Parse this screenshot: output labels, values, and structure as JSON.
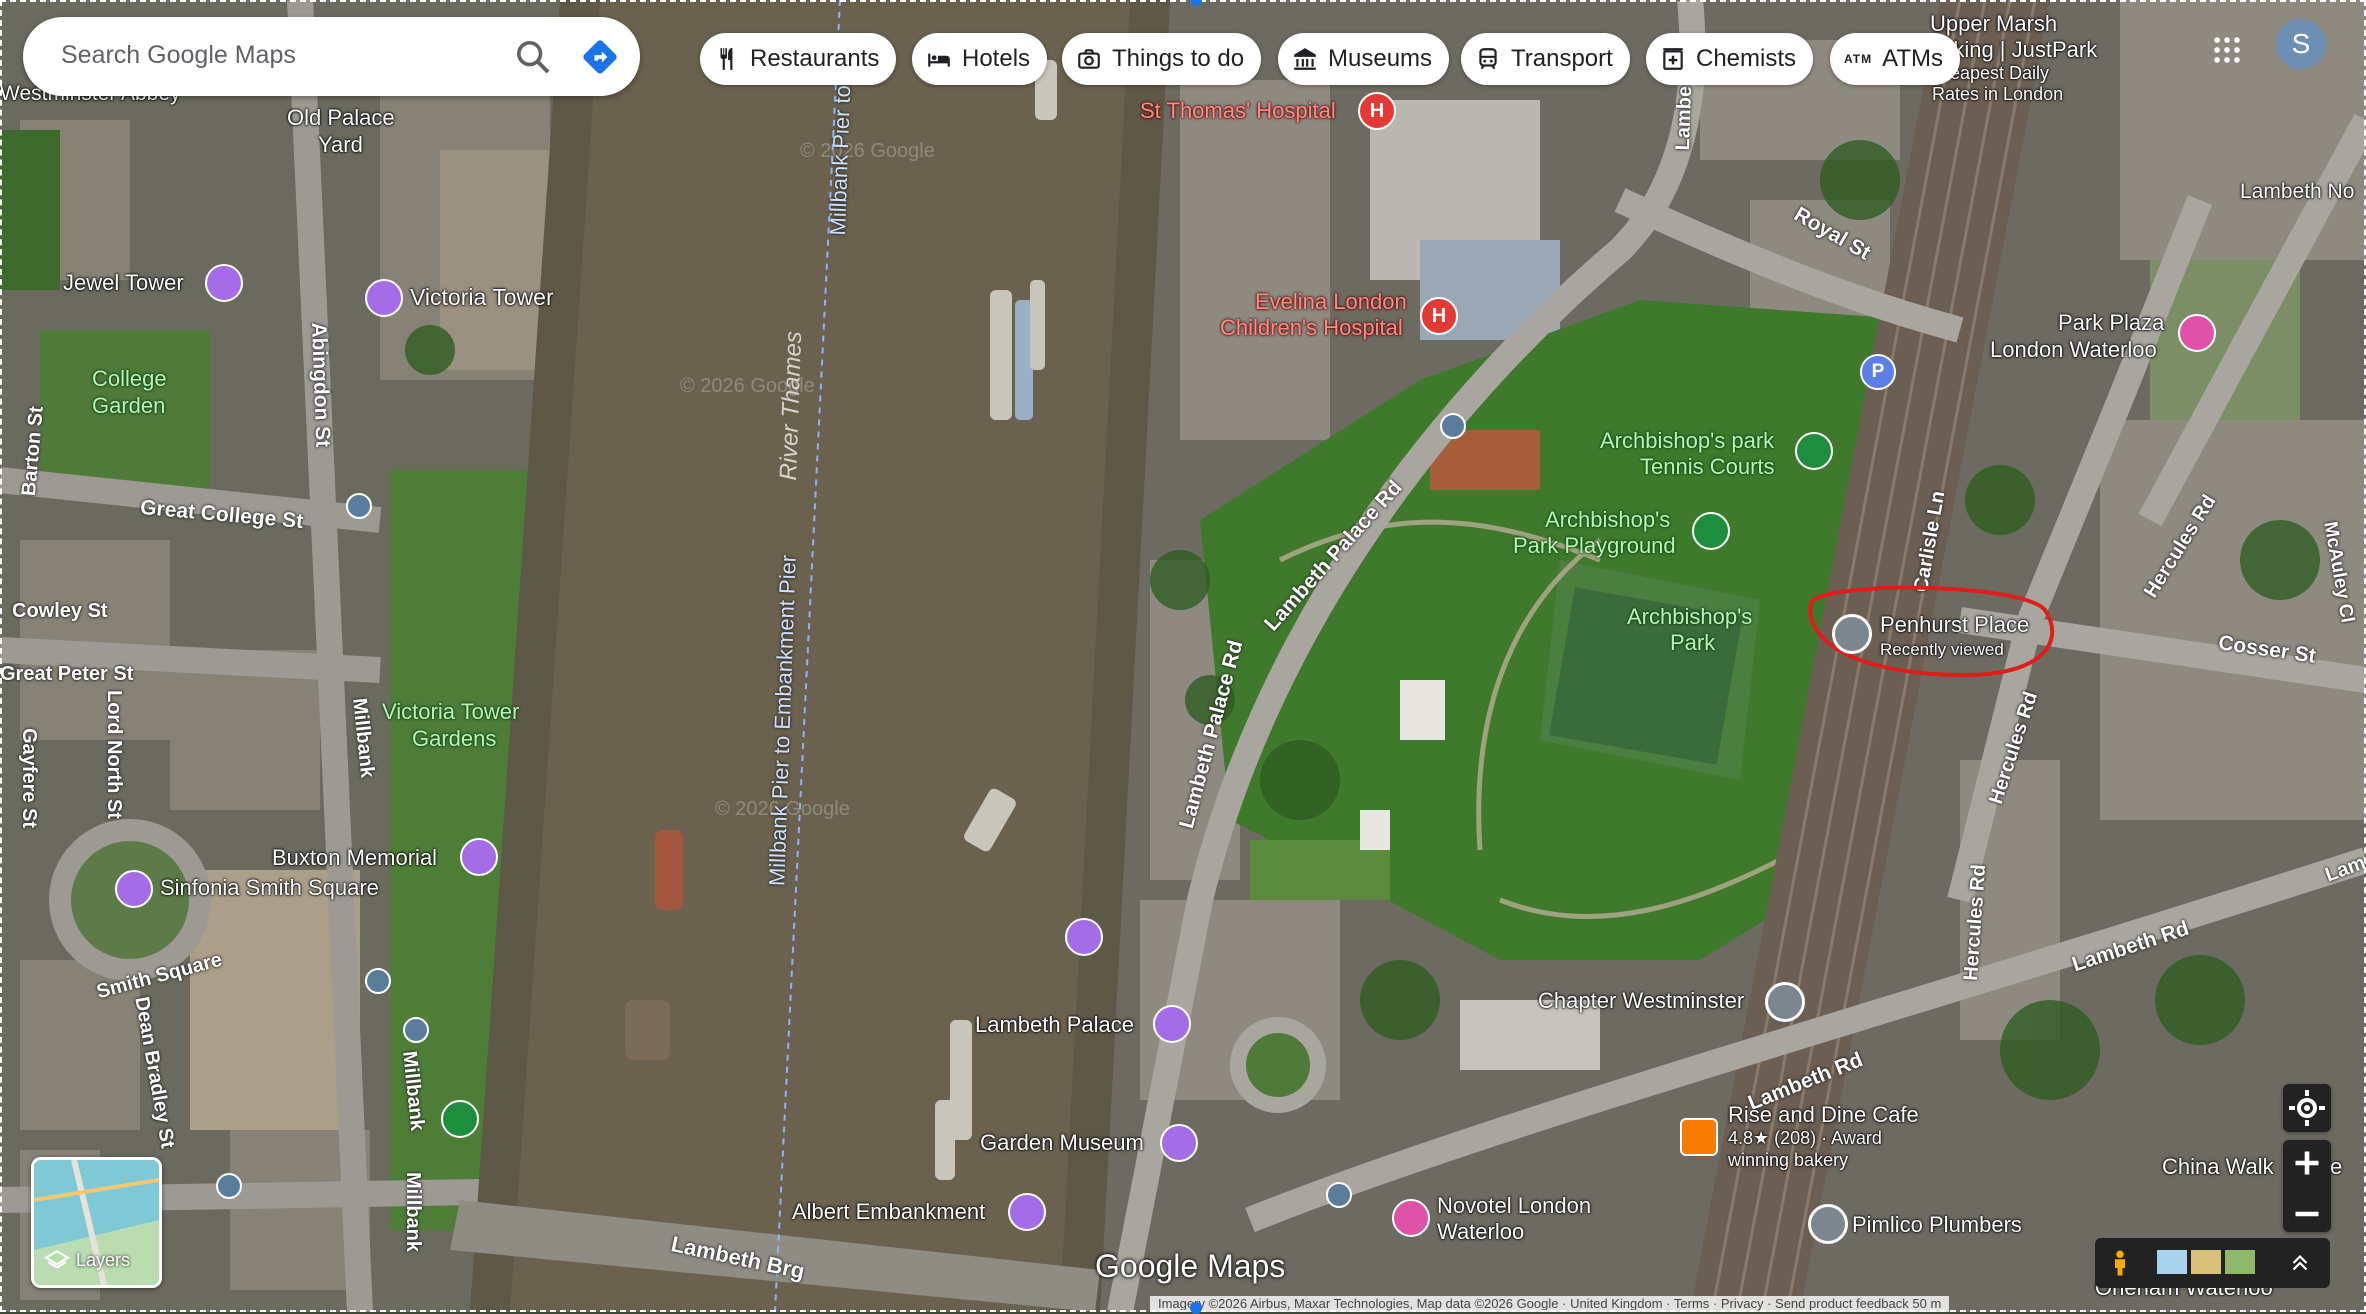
{
  "search": {
    "placeholder": "Search Google Maps"
  },
  "chips": [
    {
      "label": "Restaurants",
      "icon": "cutlery-icon"
    },
    {
      "label": "Hotels",
      "icon": "bed-icon"
    },
    {
      "label": "Things to do",
      "icon": "camera-icon"
    },
    {
      "label": "Museums",
      "icon": "museum-icon"
    },
    {
      "label": "Transport",
      "icon": "train-icon"
    },
    {
      "label": "Chemists",
      "icon": "pharmacy-icon"
    },
    {
      "label": "ATMs",
      "icon": "atm-icon",
      "icon_text": "ATM"
    }
  ],
  "avatar": {
    "initial": "S"
  },
  "layers": {
    "label": "Layers"
  },
  "logo": {
    "text": "Google Maps"
  },
  "attribution": {
    "imagery": "Imagery ©2026 Airbus, Maxar Technologies, Map data ©2026 Google",
    "region": "United Kingdom",
    "terms": "Terms",
    "privacy": "Privacy",
    "feedback": "Send product feedback",
    "scale": "50 m"
  },
  "watermark": "© 2026 Google",
  "river_label": "River Thames",
  "pier_label_1": "Millbank Pier to Embankment Pier",
  "pier_label_2": "Millbank Pier to",
  "places": {
    "westminster_abbey": "Westminster Abbey",
    "old_palace_yard_1": "Old Palace",
    "old_palace_yard_2": "Yard",
    "jewel_tower": "Jewel Tower",
    "victoria_tower": "Victoria Tower",
    "college_garden_1": "College",
    "college_garden_2": "Garden",
    "victoria_tower_gardens_1": "Victoria Tower",
    "victoria_tower_gardens_2": "Gardens",
    "buxton_memorial": "Buxton Memorial",
    "sinfonia": "Sinfonia Smith Square",
    "st_thomas": "St Thomas' Hospital",
    "evelina_1": "Evelina London",
    "evelina_2": "Children's Hospital",
    "tennis_1": "Archbishop's park",
    "tennis_2": "Tennis Courts",
    "playground_1": "Archbishop's",
    "playground_2": "Park Playground",
    "park_1": "Archbishop's",
    "park_2": "Park",
    "penhurst": "Penhurst Place",
    "penhurst_sub": "Recently viewed",
    "chapter": "Chapter Westminster",
    "lambeth_palace": "Lambeth Palace",
    "garden_museum": "Garden Museum",
    "albert_embankment": "Albert Embankment",
    "novotel_1": "Novotel London",
    "novotel_2": "Waterloo",
    "rise_1": "Rise and Dine Cafe",
    "rise_2": "4.8★ (208) · Award",
    "rise_3": "winning bakery",
    "pimlico": "Pimlico Plumbers",
    "park_plaza_1": "Park Plaza",
    "park_plaza_2": "London Waterloo",
    "upper_marsh_1": "Upper Marsh",
    "upper_marsh_2": "rking | JustPark",
    "upper_marsh_3": "eapest Daily",
    "upper_marsh_4": "Rates in London",
    "lambeth_north": "Lambeth No",
    "china_walk": "China Walk",
    "china_walk_tail": "e",
    "oneham": "Oneham Waterloo",
    "parking": "P"
  },
  "roads": {
    "abingdon": "Abingdon St",
    "great_college": "Great College St",
    "cowley": "Cowley St",
    "great_peter": "Great Peter St",
    "lord_north": "Lord North St",
    "gayfere": "Gayfere St",
    "smith_square": "Smith Square",
    "dean_bradley": "Dean Bradley St",
    "millbank_1": "Millbank",
    "millbank_2": "Millbank",
    "barton": "Barton St",
    "lambeth_palace_rd_1": "Lambeth Palace Rd",
    "lambeth_palace_rd_2": "Lambeth Palace Rd",
    "royal": "Royal St",
    "carlisle": "Carlisle Ln",
    "hercules_1": "Hercules Rd",
    "hercules_2": "Hercules Rd",
    "hercules_3": "Hercules Rd",
    "cosser": "Cosser St",
    "lambeth_rd_1": "Lambeth Rd",
    "lambeth_rd_2": "Lambeth Rd",
    "lambeth_brg": "Lambeth Brg",
    "mcauley": "McAuley Cl",
    "lambeth_top": "Lambe",
    "lambeth_right": "Lam"
  }
}
